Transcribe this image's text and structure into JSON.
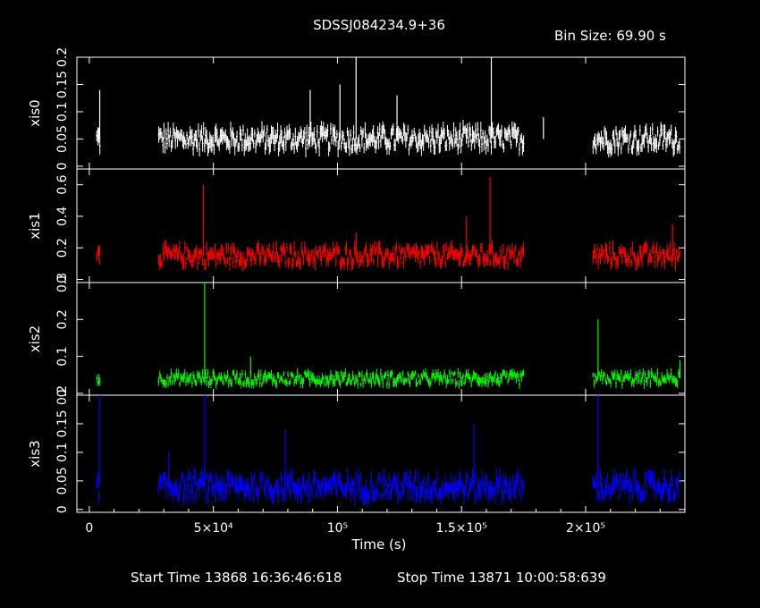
{
  "chart_data": {
    "type": "line",
    "title": "SDSSJ084234.9+36",
    "bin_size_label": "Bin Size: 69.90 s",
    "xlabel": "Time (s)",
    "xlim": [
      -5000,
      240000
    ],
    "x_ticks": [
      0,
      50000,
      100000,
      150000,
      200000
    ],
    "x_tick_labels": [
      "0",
      "5×10⁴",
      "10⁵",
      "1.5×10⁵",
      "2×10⁵"
    ],
    "segments": [
      [
        3000,
        4500
      ],
      [
        28000,
        175000
      ],
      [
        203000,
        238000
      ]
    ],
    "start_time_label": "Start Time 13868 16:36:46:618",
    "stop_time_label": "Stop Time 13871 10:00:58:639",
    "series": [
      {
        "name": "xis0",
        "color": "#ffffff",
        "ylim": [
          -0.005,
          0.2
        ],
        "baseline": 0.05,
        "noise": 0.012,
        "ticks": [
          0,
          0.05,
          0.1,
          0.15,
          0.2
        ],
        "tick_labels": [
          "0",
          "0.05",
          "0.1",
          "0.15",
          "0.2"
        ],
        "spikes": [
          {
            "t": 4200,
            "v": 0.14
          },
          {
            "t": 89000,
            "v": 0.14
          },
          {
            "t": 101000,
            "v": 0.15
          },
          {
            "t": 107500,
            "v": 0.2
          },
          {
            "t": 124000,
            "v": 0.13
          },
          {
            "t": 162000,
            "v": 0.2
          },
          {
            "t": 183000,
            "v": 0.09
          }
        ]
      },
      {
        "name": "xis1",
        "color": "#ff0000",
        "ylim": [
          -0.02,
          0.7
        ],
        "baseline": 0.15,
        "noise": 0.035,
        "ticks": [
          0,
          0.2,
          0.4,
          0.6
        ],
        "tick_labels": [
          "0",
          "0.2",
          "0.4",
          "0.6"
        ],
        "spikes": [
          {
            "t": 4200,
            "v": 0.22
          },
          {
            "t": 46000,
            "v": 0.6
          },
          {
            "t": 107500,
            "v": 0.3
          },
          {
            "t": 152000,
            "v": 0.4
          },
          {
            "t": 161500,
            "v": 0.65
          },
          {
            "t": 235000,
            "v": 0.35
          }
        ]
      },
      {
        "name": "xis2",
        "color": "#00ff00",
        "ylim": [
          -0.005,
          0.3
        ],
        "baseline": 0.04,
        "noise": 0.01,
        "ticks": [
          0,
          0.1,
          0.2,
          0.3
        ],
        "tick_labels": [
          "0",
          "0.1",
          "0.2",
          "0.3"
        ],
        "spikes": [
          {
            "t": 46500,
            "v": 0.3
          },
          {
            "t": 205000,
            "v": 0.2
          },
          {
            "t": 65000,
            "v": 0.1
          },
          {
            "t": 238000,
            "v": 0.09
          }
        ]
      },
      {
        "name": "xis3",
        "color": "#0000ff",
        "ylim": [
          -0.005,
          0.2
        ],
        "baseline": 0.04,
        "noise": 0.012,
        "ticks": [
          0,
          0.05,
          0.1,
          0.15,
          0.2
        ],
        "tick_labels": [
          "0",
          "0.05",
          "0.1",
          "0.15",
          "0.2"
        ],
        "spikes": [
          {
            "t": 4200,
            "v": 0.2
          },
          {
            "t": 46500,
            "v": 0.2
          },
          {
            "t": 79000,
            "v": 0.14
          },
          {
            "t": 155000,
            "v": 0.15
          },
          {
            "t": 205000,
            "v": 0.2
          },
          {
            "t": 32000,
            "v": 0.1
          }
        ]
      }
    ]
  }
}
